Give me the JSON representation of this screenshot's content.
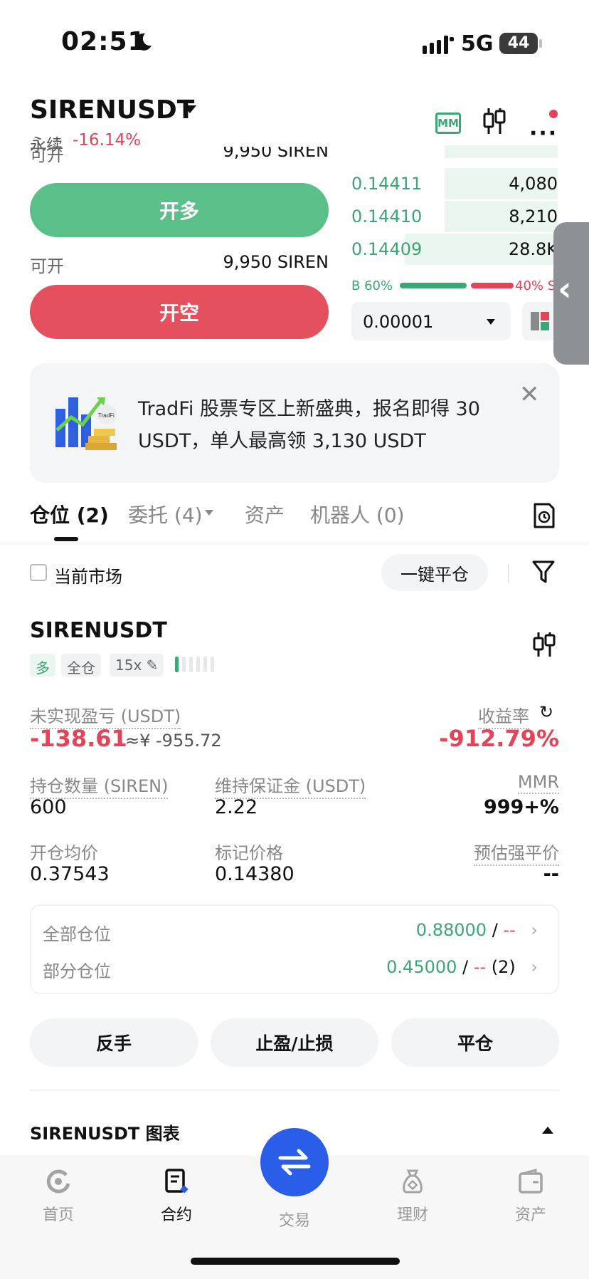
{
  "status_bar": {
    "time": "02:51",
    "network": "5G",
    "battery": "44"
  },
  "header": {
    "symbol": "SIRENUSDT",
    "contract_type": "永续",
    "change": "-16.14%",
    "mm_icon_text": "MM"
  },
  "trade_panel": {
    "open_label": "可开",
    "open_long_amount": "9,950 SIREN",
    "long_button": "开多",
    "open_short_amount": "9,950 SIREN",
    "short_button": "开空"
  },
  "order_book": {
    "rows": [
      {
        "price": "0.14411",
        "qty": "4,080",
        "depth": 0.55
      },
      {
        "price": "0.14410",
        "qty": "8,210",
        "depth": 0.55
      },
      {
        "price": "0.14409",
        "qty": "28.8K",
        "depth": 0.74
      }
    ],
    "buy_ratio": "B 60%",
    "sell_ratio": "40% S",
    "tick_size": "0.00001"
  },
  "banner": {
    "text": "TradFi 股票专区上新盛典，报名即得 30 USDT，单人最高领 3,130 USDT",
    "art_label": "TradFi"
  },
  "tabs": {
    "positions": "仓位 (2)",
    "orders": "委托 (4)",
    "assets": "资产",
    "bots": "机器人 (0)"
  },
  "filters": {
    "current_market": "当前市场",
    "close_all": "一键平仓"
  },
  "position": {
    "symbol": "SIRENUSDT",
    "side_tag": "多",
    "margin_tag": "全仓",
    "leverage_tag": "15x",
    "risk_level": 1,
    "unrealized_pnl_label": "未实现盈亏 (USDT)",
    "unrealized_pnl": "-138.61",
    "unrealized_pnl_cny": "≈¥ -955.72",
    "roe_label": "收益率",
    "roe": "-912.79%",
    "qty_label": "持仓数量 (SIREN)",
    "qty": "600",
    "maint_margin_label": "维持保证金 (USDT)",
    "maint_margin": "2.22",
    "mmr_label": "MMR",
    "mmr": "999+%",
    "entry_label": "开仓均价",
    "entry_price": "0.37543",
    "mark_label": "标记价格",
    "mark_price": "0.14380",
    "liq_label": "预估强平价",
    "liq_price": "--"
  },
  "tpsl": {
    "all_label": "全部仓位",
    "all_tp": "0.88000",
    "all_sl": "--",
    "partial_label": "部分仓位",
    "partial_tp": "0.45000",
    "partial_sl": "--",
    "partial_count": "(2)",
    "separator": "/"
  },
  "actions": {
    "reverse": "反手",
    "tpsl": "止盈/止损",
    "close": "平仓"
  },
  "chart_section": {
    "title": "SIRENUSDT 图表"
  },
  "bottom_nav": {
    "home": "首页",
    "contract": "合约",
    "trade": "交易",
    "earn": "理财",
    "assets": "资产"
  },
  "colors": {
    "green": "#3ca676",
    "red": "#e4435a",
    "blue": "#2b5ee8"
  }
}
